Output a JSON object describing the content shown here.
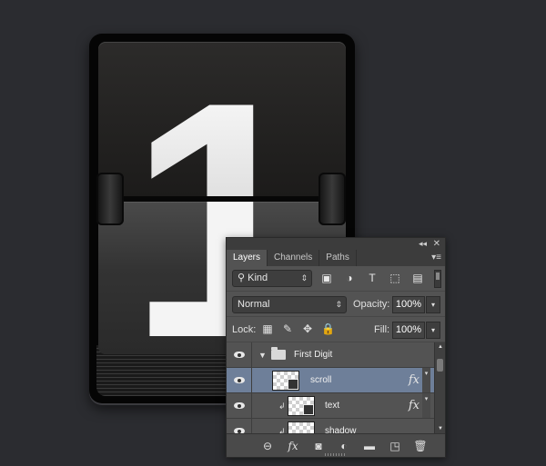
{
  "artwork": {
    "digit": "1"
  },
  "panel": {
    "tabs": [
      {
        "label": "Layers",
        "active": true
      },
      {
        "label": "Channels",
        "active": false
      },
      {
        "label": "Paths",
        "active": false
      }
    ],
    "titlebar": {
      "collapse_icon": "double-chevron-right-icon",
      "close_icon": "close-icon",
      "collapse_glyph": "◂◂",
      "close_glyph": "✕",
      "menu_glyph": "▾≡"
    },
    "filter": {
      "kind_label": "Kind",
      "search_glyph": "⚲",
      "arrow_glyph": "⇕",
      "icons": [
        {
          "name": "pixel-layer-filter-icon",
          "glyph": "▣"
        },
        {
          "name": "adjustment-layer-filter-icon",
          "glyph": "◑"
        },
        {
          "name": "type-layer-filter-icon",
          "glyph": "T"
        },
        {
          "name": "shape-layer-filter-icon",
          "glyph": "⬚"
        },
        {
          "name": "smart-object-filter-icon",
          "glyph": "▤"
        }
      ]
    },
    "blend": {
      "mode": "Normal",
      "arrow_glyph": "⇕",
      "opacity_label": "Opacity:",
      "opacity_value": "100%",
      "fill_label": "Fill:",
      "fill_value": "100%",
      "dropdown_glyph": "▾"
    },
    "lock": {
      "label": "Lock:",
      "icons": [
        {
          "name": "lock-transparent-pixels-icon",
          "glyph": "▦"
        },
        {
          "name": "lock-image-pixels-icon",
          "glyph": "✎"
        },
        {
          "name": "lock-position-icon",
          "glyph": "✥"
        },
        {
          "name": "lock-all-icon",
          "glyph": "🔒"
        }
      ]
    },
    "layers": [
      {
        "name": "First Digit",
        "type": "group",
        "expand_glyph": "▼"
      },
      {
        "name": "scroll",
        "type": "smart",
        "selected": true,
        "fx": "fx",
        "fx_arrow": "▾"
      },
      {
        "name": "text",
        "type": "smart",
        "clipped": true,
        "clip_glyph": "↲",
        "fx": "fx",
        "fx_arrow": "▾"
      },
      {
        "name": "shadow",
        "type": "layer",
        "clipped": true,
        "clip_glyph": "↲"
      }
    ],
    "scrollbar": {
      "up_glyph": "▲",
      "down_glyph": "▼"
    },
    "footer": {
      "icons": [
        {
          "name": "link-layers-icon",
          "glyph": "⊖"
        },
        {
          "name": "add-layer-style-icon",
          "glyph": "fx"
        },
        {
          "name": "add-mask-icon",
          "glyph": "◙"
        },
        {
          "name": "new-adjustment-layer-icon",
          "glyph": "◐"
        },
        {
          "name": "new-group-icon",
          "glyph": "▬"
        },
        {
          "name": "new-layer-icon",
          "glyph": "◳"
        },
        {
          "name": "delete-layer-icon",
          "glyph": "🗑"
        }
      ]
    }
  }
}
